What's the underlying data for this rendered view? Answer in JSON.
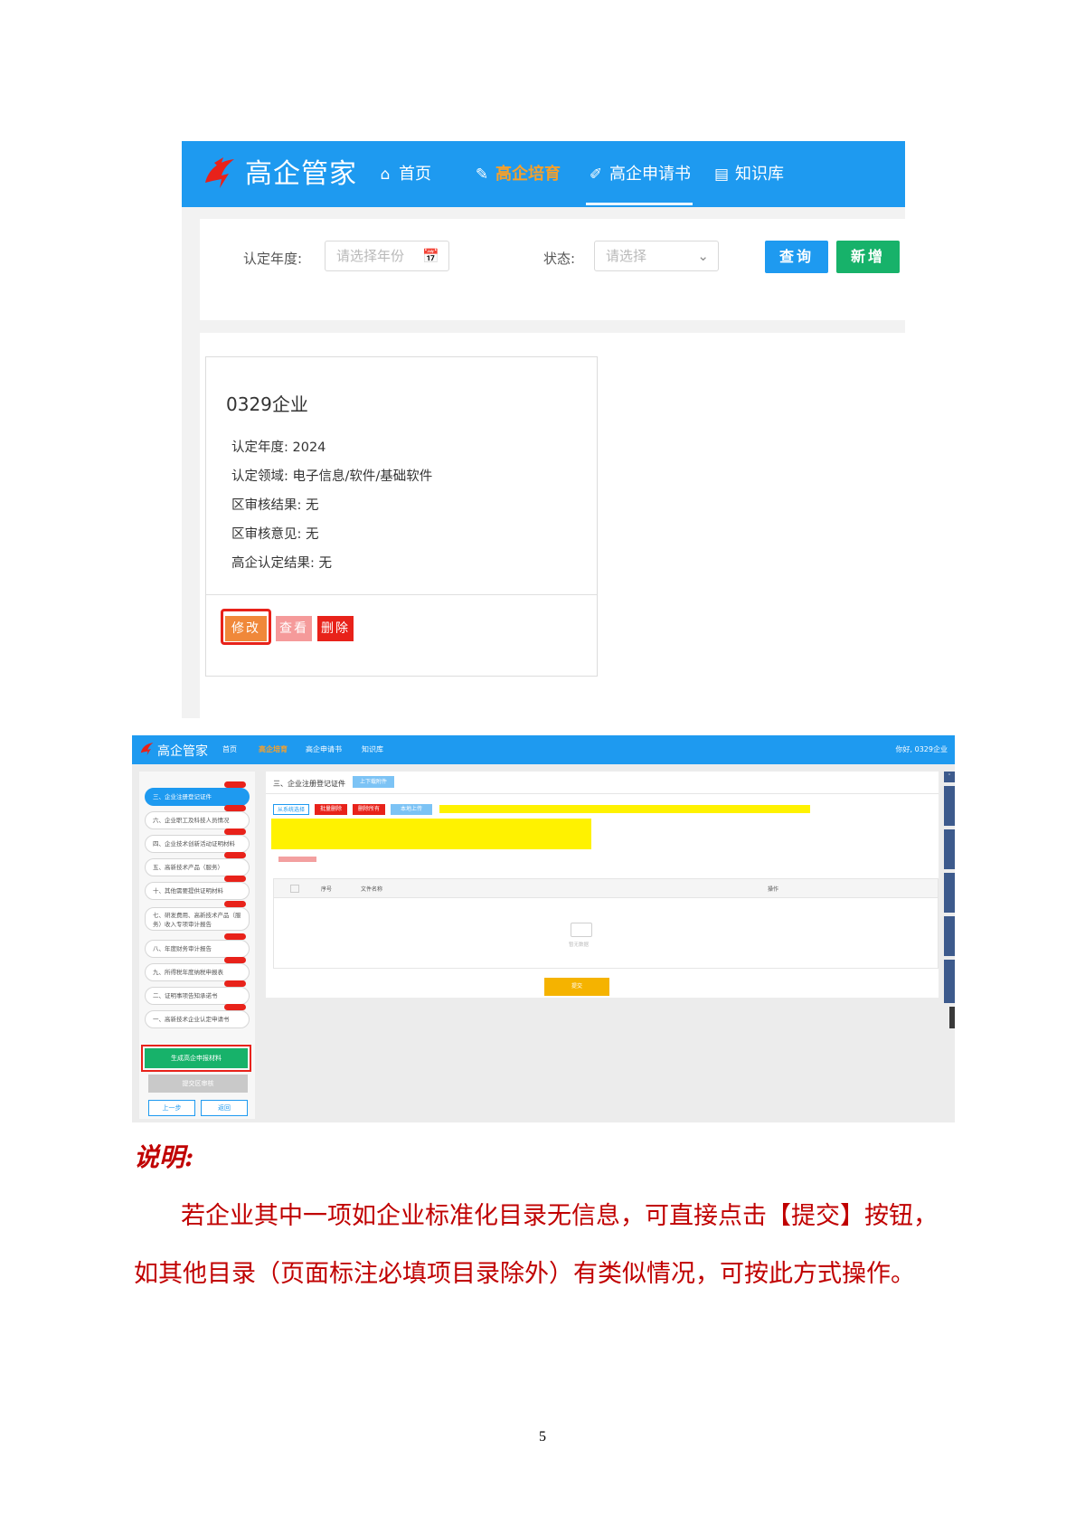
{
  "shot1": {
    "brand": "高企管家",
    "nav": [
      {
        "icon": "home-icon",
        "label": "首页"
      },
      {
        "icon": "pen-icon",
        "label": "高企培育"
      },
      {
        "icon": "edit-icon",
        "label": "高企申请书"
      },
      {
        "icon": "book-icon",
        "label": "知识库"
      }
    ],
    "filters": {
      "year_label": "认定年度:",
      "year_placeholder": "请选择年份",
      "status_label": "状态:",
      "status_placeholder": "请选择",
      "query_button": "查询",
      "add_button": "新增"
    },
    "card": {
      "title": "0329企业",
      "fields": [
        "认定年度: 2024",
        "认定领域: 电子信息/软件/基础软件",
        "区审核结果: 无",
        "区审核意见: 无",
        "高企认定结果: 无"
      ],
      "edit_button": "修改",
      "view_button": "查看",
      "delete_button": "删除"
    }
  },
  "shot2": {
    "brand": "高企管家",
    "nav": [
      "首页",
      "高企培育",
      "高企申请书",
      "知识库"
    ],
    "user": "你好, 0329企业",
    "sidebar": [
      {
        "label": "三、企业注册登记证件",
        "active": true
      },
      {
        "label": "六、企业职工及科技人员情况"
      },
      {
        "label": "四、企业技术创新活动证明材料"
      },
      {
        "label": "五、高新技术产品（服务）"
      },
      {
        "label": "十、其他需要提供证明材料"
      },
      {
        "label": "七、研发费用、高新技术产品（服务）收入专项审计报告",
        "tall": true
      },
      {
        "label": "八、年度财务审计报告"
      },
      {
        "label": "九、所得税年度纳税申报表"
      },
      {
        "label": "二、证明事项告知承诺书"
      },
      {
        "label": "一、高新技术企业认定申请书"
      }
    ],
    "generate_button": "生成高企申报材料",
    "submit_review_button": "提交区审核",
    "prev_button": "上一步",
    "back_button": "返回",
    "section_title": "三、企业注册登记证件",
    "download_button": "上下载附件",
    "toolbar": [
      "从系统选择",
      "批量删除",
      "删除所有",
      "本地上传"
    ],
    "table_headers": [
      "序号",
      "文件名称",
      "操作"
    ],
    "empty_text": "暂无数据",
    "submit_button": "提交"
  },
  "text": {
    "heading": "说明:",
    "para_line1": "若企业其中一项如企业标准化目录无信息，可直接点击【提交】按钮，",
    "para_line2": "如其他目录（页面标注必填项目录除外）有类似情况，可按此方式操作。"
  },
  "page_number": "5"
}
